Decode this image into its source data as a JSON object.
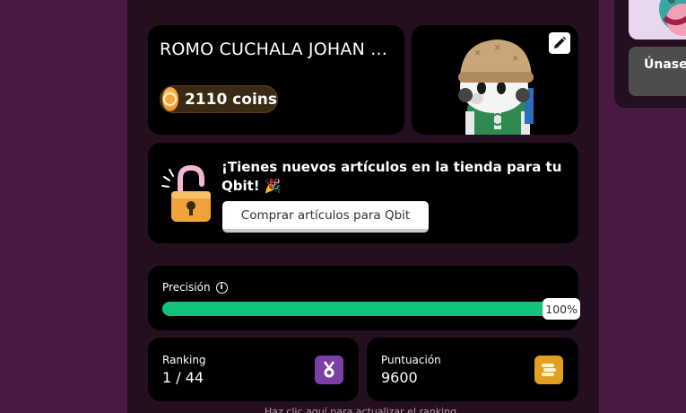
{
  "profile": {
    "name": "ROMO CUCHALA JOHAN ...",
    "coins": "2110 coins"
  },
  "avatar": {
    "edit_icon": "pencil-icon"
  },
  "shop": {
    "title": "¡Tienes nuevos artículos en la tienda para tu Qbit! 🎉",
    "button": "Comprar artículos para Qbit",
    "icon": "unlocked-padlock-icon"
  },
  "precision": {
    "label": "Precisión",
    "value": 1.0,
    "percent_text": "100%"
  },
  "ranking": {
    "label": "Ranking",
    "value": "1 / 44",
    "icon": "medal-icon"
  },
  "score": {
    "label": "Puntuación",
    "value": "9600",
    "icon": "coin-stack-icon"
  },
  "footer": {
    "hint": "Haz clic aquí para actualizar el ranking"
  },
  "side": {
    "join_button": "Únase"
  },
  "colors": {
    "background": "#4a1942",
    "panel": "#230f1f",
    "progress": "#13c27b",
    "ranking_badge": "#7b3fa6",
    "score_badge": "#e0a121"
  }
}
